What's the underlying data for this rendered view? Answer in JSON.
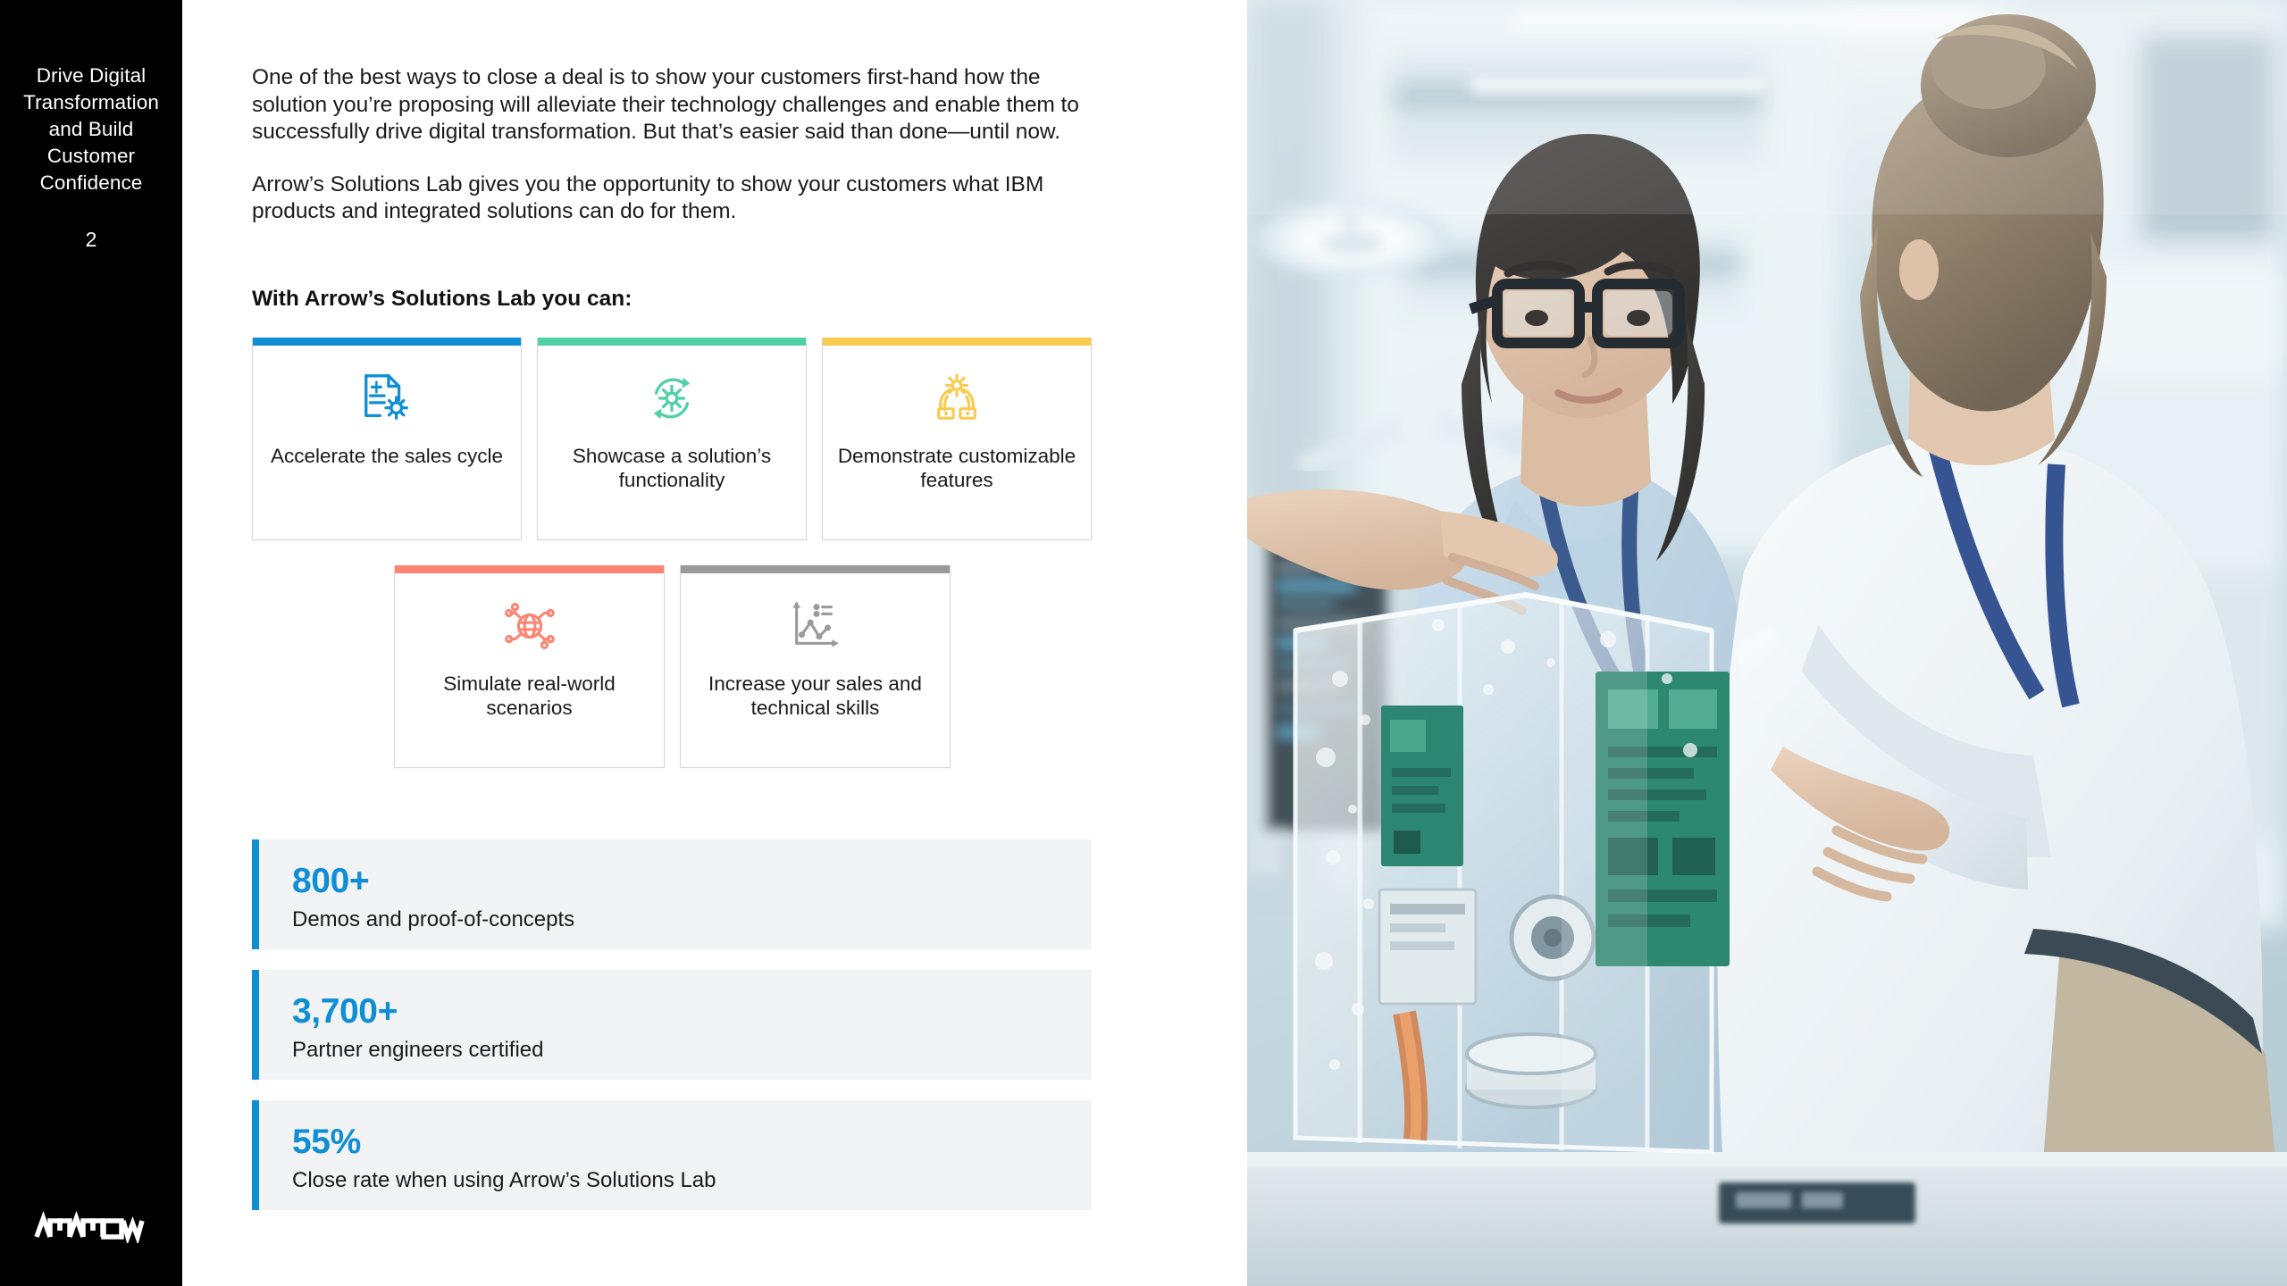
{
  "rail": {
    "title": "Drive Digital Transformation and Build Customer Confidence",
    "page_number": "2",
    "logo_name": "arrow-logo",
    "logo_text": "ARROW",
    "background": "#000000"
  },
  "body": {
    "paragraph_1": "One of the best ways to close a deal is to show your customers first-hand how the solution you’re proposing will alleviate their technology challenges and enable them to successfully drive digital transformation. But that’s easier said than done—until now.",
    "paragraph_2": "Arrow’s Solutions Lab gives you the opportunity to show your customers what IBM products and integrated solutions can do for them.",
    "subheading": "With Arrow’s Solutions Lab you can:"
  },
  "cards_row_1": [
    {
      "label": "Accelerate the sales cycle",
      "accent": "#0f8ed6",
      "icon": "document-gear-dollar-icon"
    },
    {
      "label": "Showcase a solution’s functionality",
      "accent": "#4fd1a5",
      "icon": "gear-refresh-icon"
    },
    {
      "label": "Demonstrate customizable features",
      "accent": "#fbc94c",
      "icon": "hands-gear-icon"
    }
  ],
  "cards_row_2": [
    {
      "label": "Simulate real-world scenarios",
      "accent": "#fc8573",
      "icon": "globe-network-icon"
    },
    {
      "label": "Increase your sales and technical skills",
      "accent": "#9a9a9a",
      "icon": "line-chart-icon"
    }
  ],
  "stats": [
    {
      "value": "800+",
      "label": "Demos and proof-of-concepts",
      "accent": "#0f8ed6"
    },
    {
      "value": "3,700+",
      "label": "Partner engineers certified",
      "accent": "#0f8ed6"
    },
    {
      "value": "55%",
      "label": "Close rate when using Arrow’s Solutions Lab",
      "accent": "#0f8ed6"
    }
  ],
  "photo": {
    "name": "lab-engineers-photo",
    "description": "Two women in a bright technology lab examining an open transparent computer chassis with circuit boards"
  }
}
